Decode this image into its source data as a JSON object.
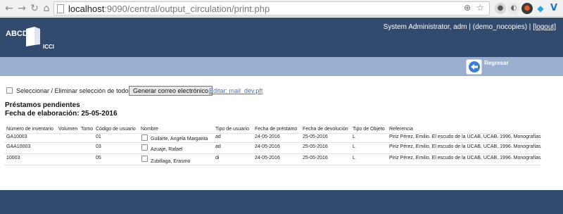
{
  "browser": {
    "url_host": "localhost",
    "url_path": ":9090/central/output_circulation/print.php"
  },
  "header": {
    "logo_main": "ABCD",
    "logo_sub": "ICCI",
    "user_text": "System Administrator, adm | (demo_nocopies) | ",
    "logout_label": "[logout]"
  },
  "subbar": {
    "back_label": "Regresar"
  },
  "actions": {
    "select_all_label": "Seleccionar / Eliminar selección de todos",
    "email_button_label": "Generar correo electrónico",
    "edit_link_label": "Editar: mail_dev.pft"
  },
  "report": {
    "title": "Préstamos pendientes",
    "date_line": "Fecha de elaboración: 25-05-2016"
  },
  "table": {
    "headers": {
      "inventory": "Número de inventario",
      "volume": "Volumen",
      "tome": "Tomo",
      "user_code": "Código de usuario",
      "name": "Nombre",
      "user_type": "Tipo de usuario",
      "loan_date": "Fecha de préstamo",
      "return_date": "Fecha de devolución",
      "object_type": "Tipo de Objeto",
      "reference": "Referencia"
    },
    "rows": [
      {
        "inventory": "GA10003",
        "volume": "",
        "tome": "",
        "user_code": "01",
        "name": "Guilarte, Angela Margarita",
        "user_type": "ad",
        "loan_date": "24-05-2016",
        "return_date": "25-05-2016",
        "object_type": "L",
        "reference": "Piriz Pérez, Emilio. El escudo de la UCAB, UCAB. 1996. Monografías"
      },
      {
        "inventory": "GAA10003",
        "volume": "",
        "tome": "",
        "user_code": "03",
        "name": "Azuaje, Rafael",
        "user_type": "ad",
        "loan_date": "24-05-2016",
        "return_date": "25-05-2016",
        "object_type": "L",
        "reference": "Piriz Pérez, Emilio. El escudo de la UCAB, UCAB. 1996. Monografías"
      },
      {
        "inventory": "10003",
        "volume": "",
        "tome": "",
        "user_code": "05",
        "name": "Zubillaga, Erasmo",
        "user_type": "di",
        "loan_date": "24-05-2016",
        "return_date": "25-05-2016",
        "object_type": "L",
        "reference": "Piriz Pérez, Emilio. El escudo de la UCAB, UCAB. 1996. Monografías"
      }
    ]
  },
  "colors": {
    "header_bg": "#324a6e",
    "subbar_bg": "#9aaed0",
    "link": "#4b71b0"
  }
}
